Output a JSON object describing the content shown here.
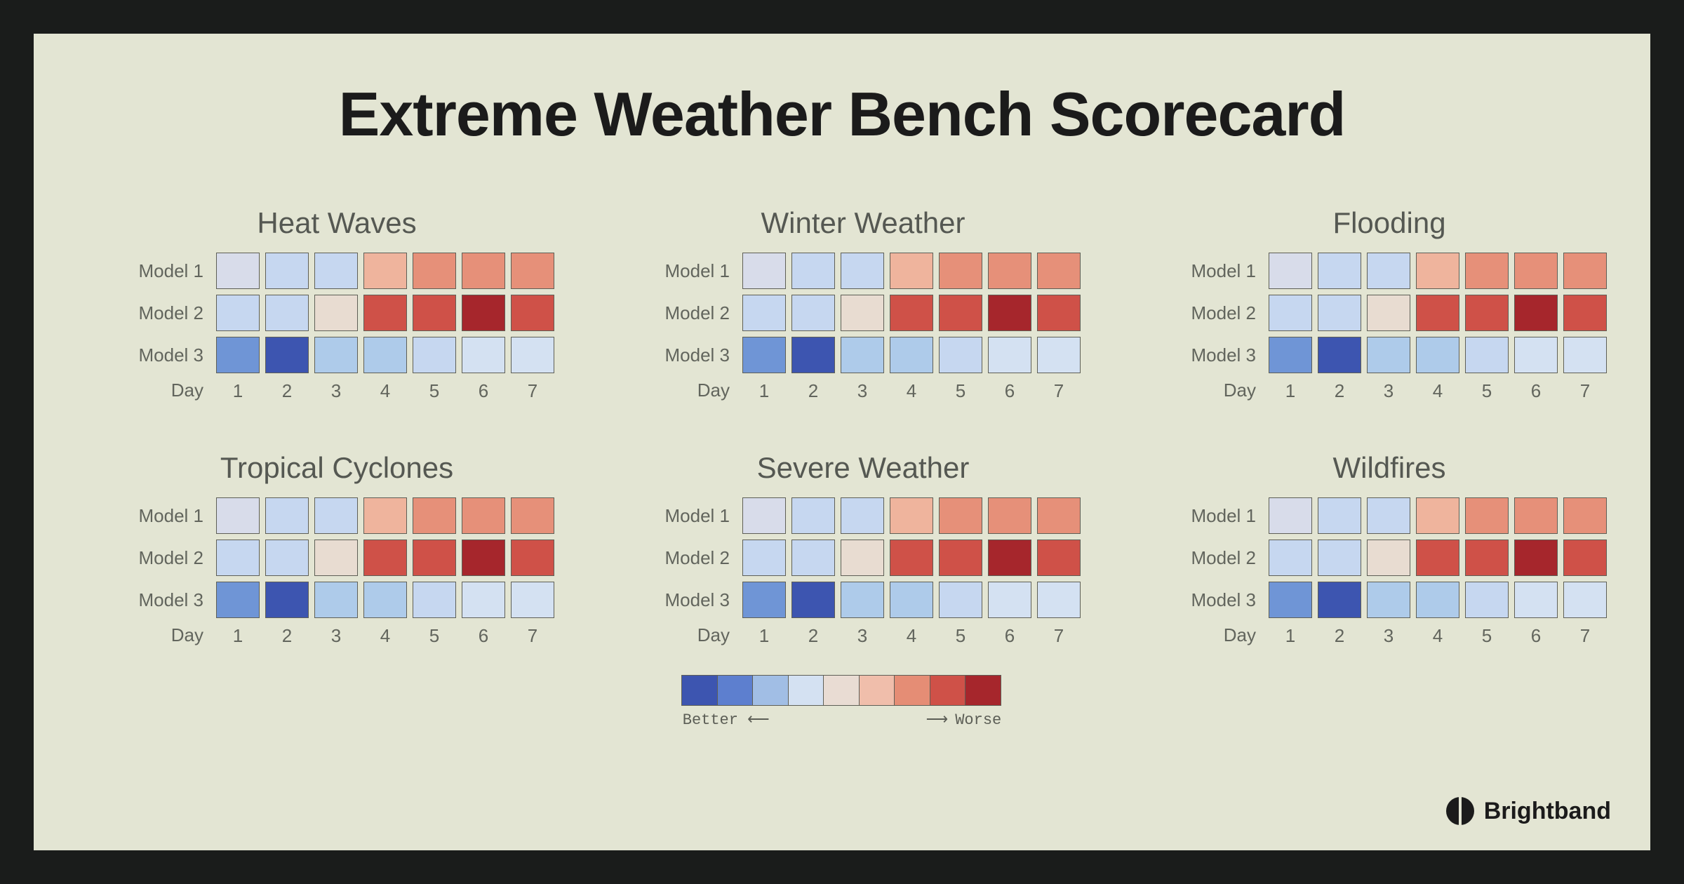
{
  "title": "Extreme Weather Bench Scorecard",
  "row_labels": [
    "Model 1",
    "Model 2",
    "Model 3"
  ],
  "day_axis_label": "Day",
  "day_ticks": [
    "1",
    "2",
    "3",
    "4",
    "5",
    "6",
    "7"
  ],
  "legend": {
    "better": "Better",
    "worse": "Worse",
    "colors": [
      "#3d55b0",
      "#5d7fcf",
      "#a1bee5",
      "#d4e1f2",
      "#e9dcd3",
      "#f0beab",
      "#e58d75",
      "#cf5148",
      "#a6262c"
    ]
  },
  "brand": "Brightband",
  "color_map": {
    "0": "#d8dcea",
    "1": "#c6d7f0",
    "2": "#aecbea",
    "3": "#6f95d6",
    "4": "#3d55b0",
    "5": "#e8dcd1",
    "6": "#efb49d",
    "7": "#e69079",
    "8": "#cf5148",
    "9": "#a6262c",
    "10": "#d4e1f2"
  },
  "chart_data": [
    {
      "title": "Heat Waves",
      "type": "heatmap",
      "x": [
        1,
        2,
        3,
        4,
        5,
        6,
        7
      ],
      "y": [
        "Model 1",
        "Model 2",
        "Model 3"
      ],
      "cells": [
        [
          0,
          1,
          1,
          6,
          7,
          7,
          7
        ],
        [
          1,
          1,
          5,
          8,
          8,
          9,
          8
        ],
        [
          3,
          4,
          2,
          2,
          1,
          10,
          10
        ]
      ]
    },
    {
      "title": "Winter Weather",
      "type": "heatmap",
      "x": [
        1,
        2,
        3,
        4,
        5,
        6,
        7
      ],
      "y": [
        "Model 1",
        "Model 2",
        "Model 3"
      ],
      "cells": [
        [
          0,
          1,
          1,
          6,
          7,
          7,
          7
        ],
        [
          1,
          1,
          5,
          8,
          8,
          9,
          8
        ],
        [
          3,
          4,
          2,
          2,
          1,
          10,
          10
        ]
      ]
    },
    {
      "title": "Flooding",
      "type": "heatmap",
      "x": [
        1,
        2,
        3,
        4,
        5,
        6,
        7
      ],
      "y": [
        "Model 1",
        "Model 2",
        "Model 3"
      ],
      "cells": [
        [
          0,
          1,
          1,
          6,
          7,
          7,
          7
        ],
        [
          1,
          1,
          5,
          8,
          8,
          9,
          8
        ],
        [
          3,
          4,
          2,
          2,
          1,
          10,
          10
        ]
      ]
    },
    {
      "title": "Tropical Cyclones",
      "type": "heatmap",
      "x": [
        1,
        2,
        3,
        4,
        5,
        6,
        7
      ],
      "y": [
        "Model 1",
        "Model 2",
        "Model 3"
      ],
      "cells": [
        [
          0,
          1,
          1,
          6,
          7,
          7,
          7
        ],
        [
          1,
          1,
          5,
          8,
          8,
          9,
          8
        ],
        [
          3,
          4,
          2,
          2,
          1,
          10,
          10
        ]
      ]
    },
    {
      "title": "Severe Weather",
      "type": "heatmap",
      "x": [
        1,
        2,
        3,
        4,
        5,
        6,
        7
      ],
      "y": [
        "Model 1",
        "Model 2",
        "Model 3"
      ],
      "cells": [
        [
          0,
          1,
          1,
          6,
          7,
          7,
          7
        ],
        [
          1,
          1,
          5,
          8,
          8,
          9,
          8
        ],
        [
          3,
          4,
          2,
          2,
          1,
          10,
          10
        ]
      ]
    },
    {
      "title": "Wildfires",
      "type": "heatmap",
      "x": [
        1,
        2,
        3,
        4,
        5,
        6,
        7
      ],
      "y": [
        "Model 1",
        "Model 2",
        "Model 3"
      ],
      "cells": [
        [
          0,
          1,
          1,
          6,
          7,
          7,
          7
        ],
        [
          1,
          1,
          5,
          8,
          8,
          9,
          8
        ],
        [
          3,
          4,
          2,
          2,
          1,
          10,
          10
        ]
      ]
    }
  ]
}
